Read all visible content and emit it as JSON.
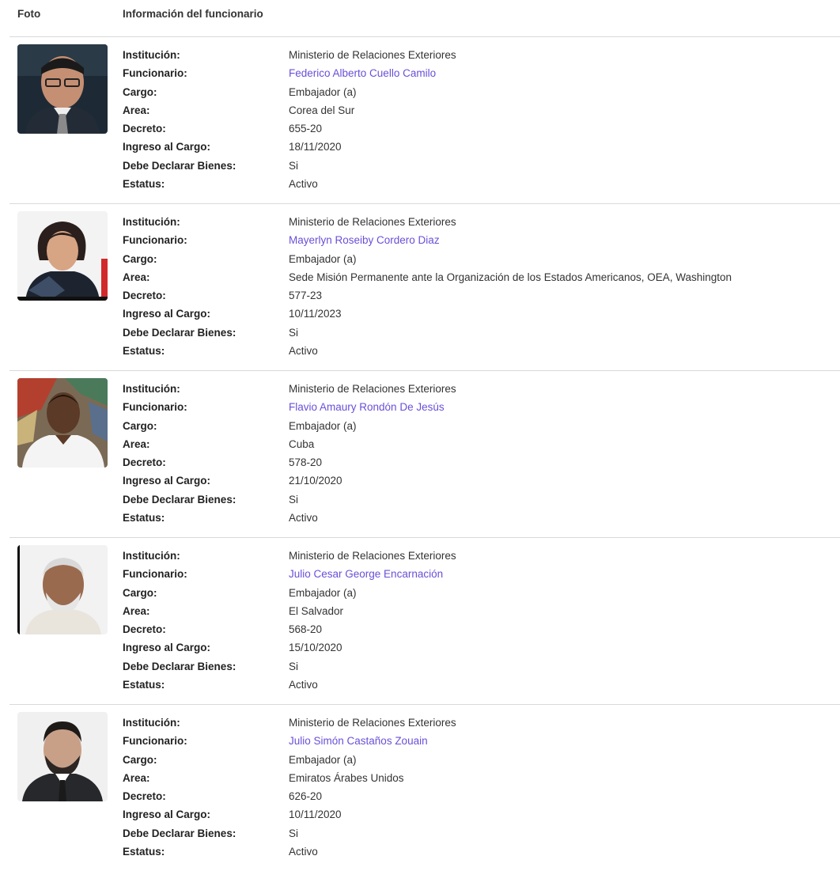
{
  "header": {
    "photo_col": "Foto",
    "info_col": "Información del funcionario"
  },
  "labels": {
    "institucion": "Institución:",
    "funcionario": "Funcionario:",
    "cargo": "Cargo:",
    "area": "Area:",
    "decreto": "Decreto:",
    "ingreso": "Ingreso al Cargo:",
    "bienes": "Debe Declarar Bienes:",
    "estatus": "Estatus:"
  },
  "records": [
    {
      "institucion": "Ministerio de Relaciones Exteriores",
      "funcionario": "Federico Alberto Cuello Camilo",
      "cargo": "Embajador (a)",
      "area": "Corea del Sur",
      "decreto": "655-20",
      "ingreso": "18/11/2020",
      "bienes": "Si",
      "estatus": "Activo"
    },
    {
      "institucion": "Ministerio de Relaciones Exteriores",
      "funcionario": "Mayerlyn Roseiby Cordero Diaz",
      "cargo": "Embajador (a)",
      "area": "Sede Misión Permanente ante la Organización de los Estados Americanos, OEA, Washington",
      "decreto": "577-23",
      "ingreso": "10/11/2023",
      "bienes": "Si",
      "estatus": "Activo"
    },
    {
      "institucion": "Ministerio de Relaciones Exteriores",
      "funcionario": "Flavio Amaury Rondón De Jesús",
      "cargo": "Embajador (a)",
      "area": "Cuba",
      "decreto": "578-20",
      "ingreso": "21/10/2020",
      "bienes": "Si",
      "estatus": "Activo"
    },
    {
      "institucion": "Ministerio de Relaciones Exteriores",
      "funcionario": "Julio Cesar George Encarnación",
      "cargo": "Embajador (a)",
      "area": "El Salvador",
      "decreto": "568-20",
      "ingreso": "15/10/2020",
      "bienes": "Si",
      "estatus": "Activo"
    },
    {
      "institucion": "Ministerio de Relaciones Exteriores",
      "funcionario": "Julio Simón Castaños Zouain",
      "cargo": "Embajador (a)",
      "area": "Emiratos Árabes Unidos",
      "decreto": "626-20",
      "ingreso": "10/11/2020",
      "bienes": "Si",
      "estatus": "Activo"
    }
  ],
  "colors": {
    "link": "#6a4fd8",
    "divider": "#d9d9d9"
  }
}
